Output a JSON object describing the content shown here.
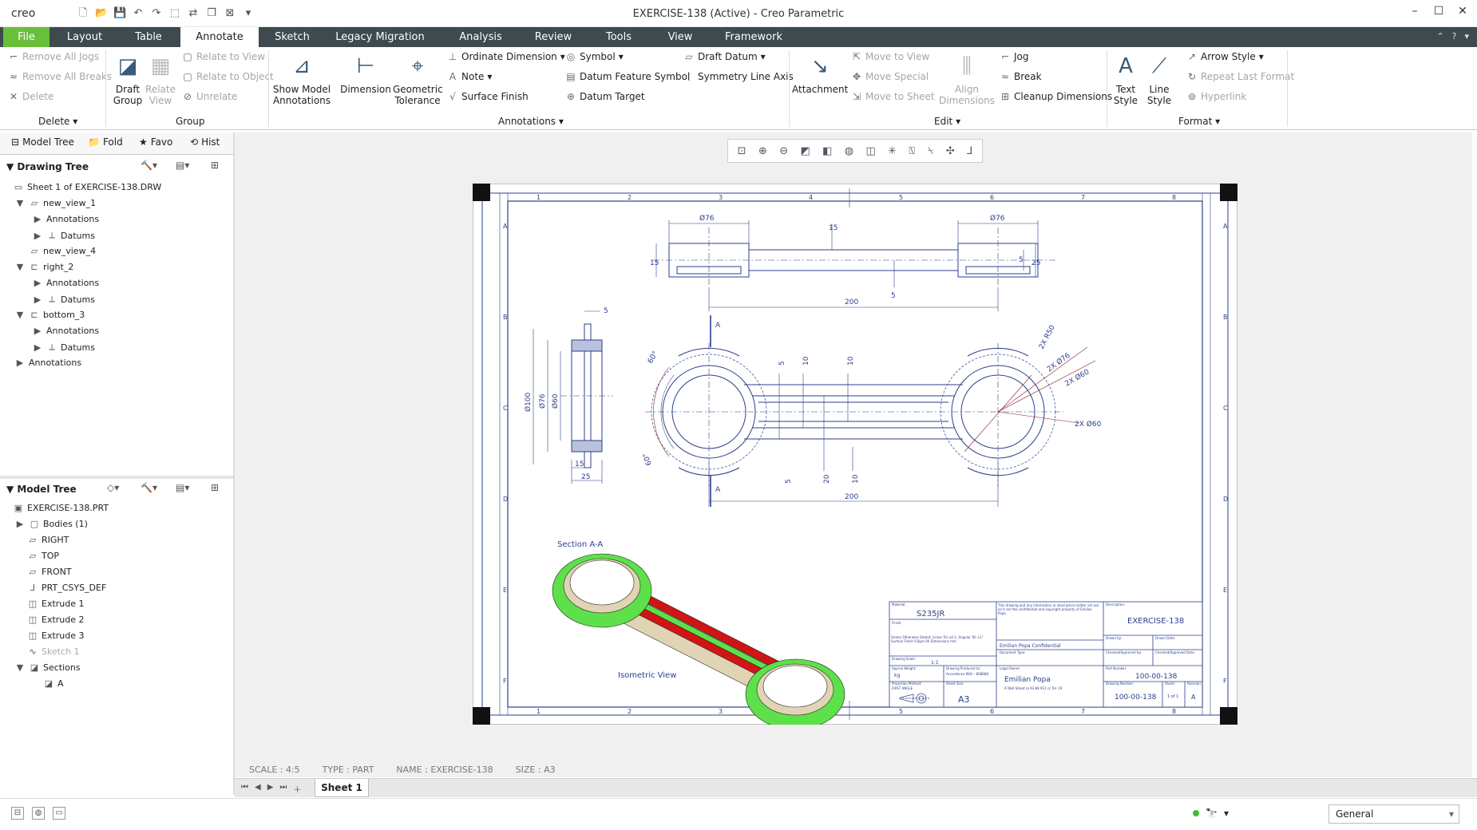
{
  "app": {
    "logo": "creo",
    "title": "EXERCISE-138 (Active) - Creo Parametric"
  },
  "ribbon_tabs": [
    "File",
    "Layout",
    "Table",
    "Annotate",
    "Sketch",
    "Legacy Migration",
    "Analysis",
    "Review",
    "Tools",
    "View",
    "Framework"
  ],
  "active_tab": "Annotate",
  "ribbon": {
    "delete_group": {
      "remove_all_jogs": "Remove All Jogs",
      "remove_all_breaks": "Remove All Breaks",
      "delete": "Delete",
      "label": "Delete"
    },
    "group_group": {
      "draft_group": "Draft Group",
      "relate_view": "Relate View",
      "relate_to_view": "Relate to View",
      "relate_to_object": "Relate to Object",
      "unrelate": "Unrelate",
      "label": "Group"
    },
    "annotations_group": {
      "show_model_annotations": "Show Model Annotations",
      "dimension": "Dimension",
      "geometric_tolerance": "Geometric Tolerance",
      "ordinate_dimension": "Ordinate Dimension",
      "note": "Note",
      "surface_finish": "Surface Finish",
      "symbol": "Symbol",
      "datum_feature_symbol": "Datum Feature Symbol",
      "datum_target": "Datum Target",
      "draft_datum": "Draft Datum",
      "symmetry_line_axis": "Symmetry Line Axis",
      "label": "Annotations"
    },
    "edit_group": {
      "attachment": "Attachment",
      "move_to_view": "Move to View",
      "move_special": "Move Special",
      "move_to_sheet": "Move to Sheet",
      "align_dimensions": "Align Dimensions",
      "jog": "Jog",
      "break": "Break",
      "cleanup_dimensions": "Cleanup Dimensions",
      "label": "Edit"
    },
    "format_group": {
      "text_style": "Text Style",
      "line_style": "Line Style",
      "arrow_style": "Arrow Style",
      "repeat_last_format": "Repeat Last Format",
      "hyperlink": "Hyperlink",
      "label": "Format"
    }
  },
  "nav_tabs": [
    "Model Tree",
    "Fold",
    "Favo",
    "Hist"
  ],
  "drawing_tree": {
    "title": "Drawing Tree",
    "items": [
      "Sheet 1 of EXERCISE-138.DRW",
      "new_view_1",
      "Annotations",
      "Datums",
      "new_view_4",
      "right_2",
      "Annotations",
      "Datums",
      "bottom_3",
      "Annotations",
      "Datums",
      "Annotations"
    ]
  },
  "model_tree": {
    "title": "Model Tree",
    "items": [
      "EXERCISE-138.PRT",
      "Bodies (1)",
      "RIGHT",
      "TOP",
      "FRONT",
      "PRT_CSYS_DEF",
      "Extrude 1",
      "Extrude 2",
      "Extrude 3",
      "Sketch 1",
      "Sections",
      "A"
    ]
  },
  "drawing": {
    "columns": [
      "1",
      "2",
      "3",
      "4",
      "5",
      "6",
      "7",
      "8"
    ],
    "rows": [
      "A",
      "B",
      "C",
      "D",
      "E",
      "F"
    ],
    "dims": {
      "d76a": "Ø76",
      "d76b": "Ø76",
      "d15a": "15",
      "d15b": "15",
      "d5a": "5",
      "d5b": "5",
      "d25a": "25",
      "d200a": "200",
      "d200b": "200",
      "r50": "2X R50",
      "d76c": "2X Ø76",
      "d60a": "2X Ø60",
      "d60b": "2X Ø60",
      "a60a": "60°",
      "a60b": "60°",
      "d10a": "10",
      "d10b": "10",
      "d10c": "10",
      "d20": "20",
      "d5c": "5",
      "d5d": "5",
      "sec5": "5",
      "sec100": "Ø100",
      "sec76": "Ø76",
      "sec60": "Ø60",
      "sec15": "15",
      "sec25": "25",
      "labelA1": "A",
      "labelA2": "A"
    },
    "section_label": "Section A-A",
    "iso_label": "Isometric View",
    "title_block": {
      "material_label": "Material:",
      "material": "S235JR",
      "finish_label": "Finish:",
      "notes": "Unless Otherwise Stated: Linear Tol ±0.1, Angular Tol ±1° Surface Finish 0.8µm All Dimensions mm",
      "drawing_scale_label": "Drawing Scale:",
      "drawing_scale": "1:1",
      "weight_label": "Approx Weight:",
      "weight": "kg",
      "projection_label": "Projection Method:",
      "projection": "FIRST ANGLE",
      "produced_label": "Drawing Produced to:",
      "produced": "Accordance With : BS8888",
      "sheet_size_label": "Sheet Size:",
      "sheet_size": "A3",
      "confidential_text": "This drawing and any information or descriptive matter set out on it are the confidential and copyright property of Emilian Popa.",
      "confidential": "Emilian Popa Confidential",
      "document_label": "Document Type:",
      "legal_label": "Legal Owner:",
      "owner": "Emilian Popa",
      "owner_addr": "9 Wall Street ro 93 88 912 cc Tel. 19",
      "description_label": "Description:",
      "description": "EXERCISE-138",
      "drawn_label": "Drawn by:",
      "drawn_date_label": "Drawn Date:",
      "checked_label": "Checked/Approved by:",
      "checked_date_label": "Checked/Approved Date:",
      "part_label": "Part Number:",
      "part": "100-00-138",
      "dwg_label": "Drawing Number:",
      "dwg": "100-00-138",
      "sheet_label": "Sheet:",
      "sheet": "1 of 1",
      "rev_label": "Revision:",
      "rev": "A"
    }
  },
  "status": {
    "scale": "SCALE : 4:5",
    "type": "TYPE : PART",
    "name": "NAME : EXERCISE-138",
    "size": "SIZE : A3"
  },
  "sheet_tab": "Sheet 1",
  "filter": "General",
  "colors": {
    "accent_green": "#6abf3a",
    "tabbar": "#3e4a4d",
    "drawing_line": "#2c3f8c",
    "iso_green": "#5ee04a",
    "iso_red": "#d11414",
    "iso_tan": "#d8ccaa"
  }
}
